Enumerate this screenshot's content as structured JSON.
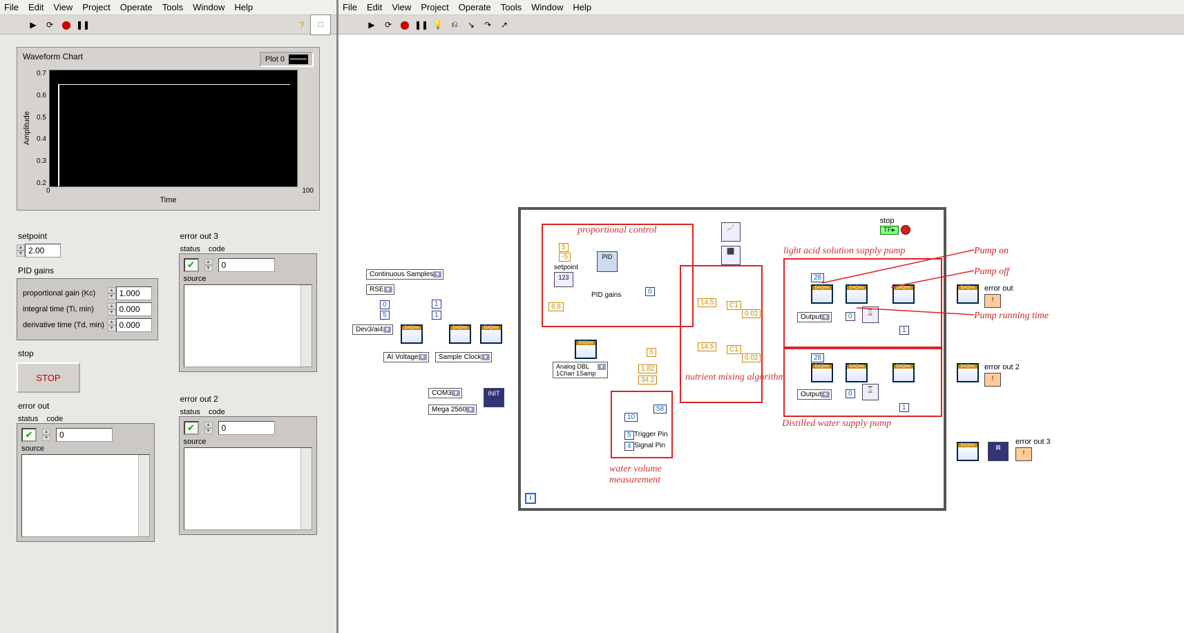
{
  "menus": [
    "File",
    "Edit",
    "View",
    "Project",
    "Operate",
    "Tools",
    "Window",
    "Help"
  ],
  "front": {
    "chart": {
      "title": "Waveform Chart",
      "legend": "Plot 0",
      "xlabel": "Time",
      "ylabel": "Amplitude",
      "yticks": [
        "0.7",
        "0.6",
        "0.5",
        "0.4",
        "0.3",
        "0.2"
      ],
      "xticks": [
        "0",
        "100"
      ]
    },
    "setpoint": {
      "label": "setpoint",
      "value": "2.00"
    },
    "pid": {
      "label": "PID gains",
      "kc_label": "proportional gain (Kc)",
      "kc": "1.000",
      "ti_label": "integral time (Ti, min)",
      "ti": "0.000",
      "td_label": "derivative time (Td, min)",
      "td": "0.000"
    },
    "stop": {
      "label": "stop",
      "btn": "STOP"
    },
    "err1": {
      "label": "error out",
      "status": "status",
      "code": "code",
      "codeval": "0",
      "source": "source"
    },
    "err2": {
      "label": "error out 2",
      "status": "status",
      "code": "code",
      "codeval": "0",
      "source": "source"
    },
    "err3": {
      "label": "error out 3",
      "status": "status",
      "code": "code",
      "codeval": "0",
      "source": "source"
    }
  },
  "bd": {
    "stop_label": "stop",
    "annot": {
      "prop": "proportional control",
      "acid": "light acid solution supply pump",
      "mix": "nutrient mixing algorithm",
      "dist": "Distilled water supply pump",
      "water": "water volume measurement",
      "pon": "Pump on",
      "poff": "Pump off",
      "prt": "Pump running time"
    },
    "labels": {
      "setpoint": "setpoint",
      "pidgains": "PID gains",
      "analog": "Analog DBL 1Chan 1Samp",
      "trig": "Trigger Pin",
      "sig": "Signal Pin",
      "output": "Output",
      "errout": "error out",
      "errout2": "error out 2",
      "errout3": "error out 3"
    },
    "drops": {
      "cont": "Continuous Samples",
      "rse": "RSE",
      "dev": "Dev3/ai4",
      "aiv": "AI Voltage",
      "sclk": "Sample Clock",
      "com": "COM3",
      "mega": "Mega 2560"
    },
    "consts": {
      "five": "5",
      "neg5": "-5",
      "zero": "0",
      "one": "1",
      "c68": "6.8",
      "c145": "14.5",
      "c182": "1.82",
      "c342": "34.2",
      "c002": "0.02",
      "c28": "28",
      "c10": "10",
      "c58": "58",
      "c4": "4",
      "cC1": "C1"
    }
  },
  "chart_data": {
    "type": "line",
    "title": "Waveform Chart",
    "xlabel": "Time",
    "ylabel": "Amplitude",
    "xlim": [
      0,
      100
    ],
    "ylim": [
      0.2,
      0.7
    ],
    "series": [
      {
        "name": "Plot 0",
        "x": [
          0,
          2,
          4,
          6,
          10,
          15,
          20,
          25,
          30,
          35,
          40
        ],
        "y": [
          0.22,
          0.6,
          0.67,
          0.66,
          0.68,
          0.665,
          0.675,
          0.66,
          0.67,
          0.665,
          0.67
        ]
      }
    ]
  }
}
